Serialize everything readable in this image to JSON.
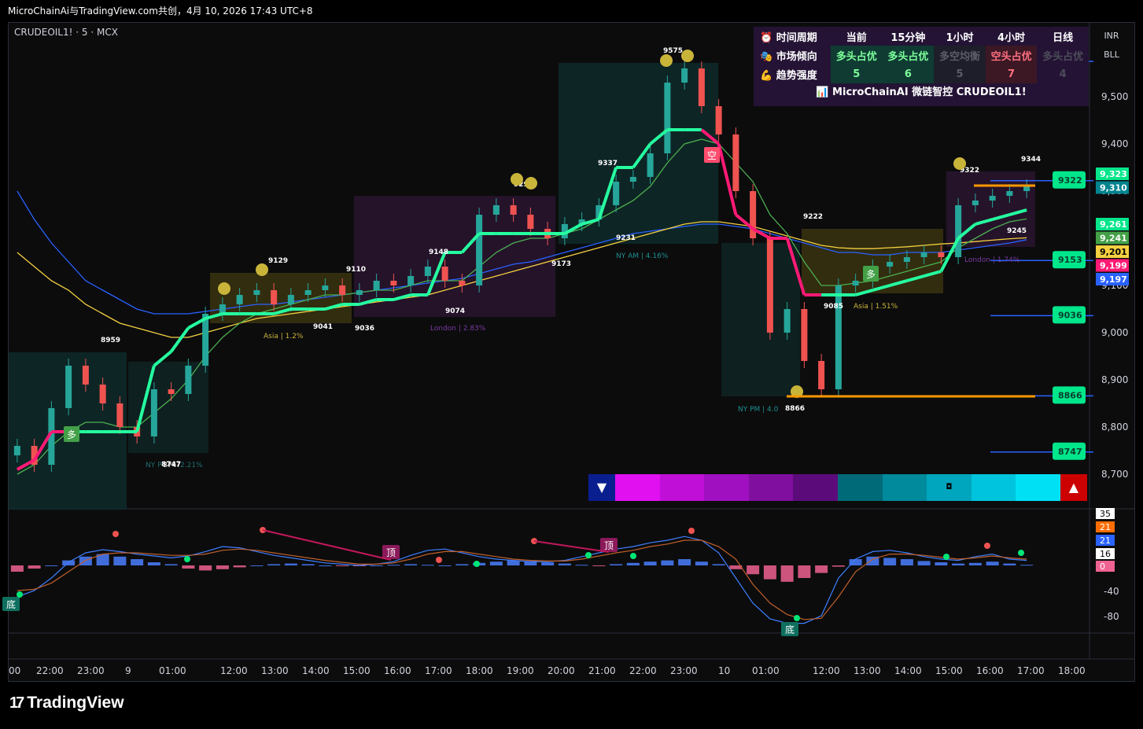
{
  "header": {
    "title": "MicroChainAi与TradingView.com共创，4月 10, 2026 17:43 UTC+8"
  },
  "symbol": {
    "name": "CRUDEOIL1! · 5 · MCX"
  },
  "currency_box": {
    "currency": "INR",
    "unit": "BLL"
  },
  "watermark": "TradingView",
  "info_table": {
    "headers": [
      "时间周期",
      "当前",
      "15分钟",
      "1小时",
      "4小时",
      "日线"
    ],
    "trend_row": {
      "label": "市场倾向",
      "cells": [
        "多头占优",
        "多头占优",
        "多空均衡",
        "空头占优",
        "多头占优"
      ],
      "tones": [
        "bull",
        "bull",
        "neutral",
        "bear",
        "dim"
      ]
    },
    "strength_row": {
      "label": "趋势强度",
      "cells": [
        "5",
        "6",
        "5",
        "7",
        "4"
      ],
      "tones": [
        "bull",
        "bull",
        "neutral",
        "bear",
        "dim"
      ]
    },
    "footer": "MicroChainAI 微链智控 CRUDEOIL1!",
    "icons": [
      "alarm-clock-icon",
      "market-bias-icon",
      "strength-arm-icon",
      "chart-icon"
    ]
  },
  "colors": {
    "bull": "#00e68a",
    "bear": "#ff1a75",
    "trend_line": "#25ffa0",
    "ema_blue": "#2962ff",
    "ema_yellow": "#f5d040",
    "ema_green": "#4caf50",
    "macd_pos": "#4a7fff",
    "macd_neg": "#f06292"
  },
  "chart_data": [
    {
      "type": "candlestick",
      "title": "CRUDEOIL1! · 5 · MCX",
      "x_ticks": [
        "00",
        "22:00",
        "23:00",
        "9",
        "01:00",
        "12:00",
        "13:00",
        "14:00",
        "15:00",
        "16:00",
        "17:00",
        "18:00",
        "19:00",
        "20:00",
        "21:00",
        "22:00",
        "23:00",
        "10",
        "01:00",
        "12:00",
        "13:00",
        "14:00",
        "15:00",
        "16:00",
        "17:00",
        "18:00"
      ],
      "y_ticks": [
        8700,
        8800,
        8900,
        9000,
        9100,
        9200,
        9300,
        9400,
        9500
      ],
      "ylim": [
        8625,
        9625
      ],
      "price_tags": [
        {
          "value": "9,323",
          "color": "#00e68a"
        },
        {
          "value": "9,310",
          "color": "#00838f"
        },
        {
          "value": "9,261",
          "color": "#00e68a"
        },
        {
          "value": "9,241",
          "color": "#43a047"
        },
        {
          "value": "9,201",
          "color": "#f5d040"
        },
        {
          "value": "9,199",
          "color": "#ff1a75"
        },
        {
          "value": "9,197",
          "color": "#2962ff"
        }
      ],
      "level_tags": [
        "9575",
        "9322",
        "9153",
        "9036",
        "8866",
        "8747"
      ],
      "swing_labels": [
        "8959",
        "8747",
        "9129",
        "9041",
        "9110",
        "9036",
        "9148",
        "9074",
        "9292",
        "9173",
        "9337",
        "9231",
        "9575",
        "9222",
        "8866",
        "9085",
        "9322",
        "9344",
        "9245"
      ],
      "session_labels": [
        "NY P",
        "8747",
        "2.21%",
        "Asia | 1.2%",
        "London | 2.83%",
        "NY AM | 4.16%",
        "NY PM | 4.0",
        "Asia | 1.51%",
        "London | 1.74%"
      ],
      "signals": [
        "多",
        "空",
        "多"
      ],
      "series": [
        {
          "name": "close",
          "values": [
            8760,
            8720,
            8840,
            8930,
            8890,
            8850,
            8800,
            8780,
            8880,
            8870,
            8930,
            9040,
            9060,
            9080,
            9090,
            9060,
            9080,
            9090,
            9100,
            9080,
            9090,
            9110,
            9100,
            9120,
            9140,
            9110,
            9100,
            9250,
            9270,
            9250,
            9220,
            9200,
            9230,
            9240,
            9270,
            9320,
            9330,
            9380,
            9530,
            9560,
            9480,
            9420,
            9300,
            9200,
            9000,
            9050,
            8940,
            8880,
            9100,
            9110,
            9140,
            9150,
            9160,
            9170,
            9160,
            9270,
            9280,
            9290,
            9300,
            9310
          ]
        },
        {
          "name": "trend",
          "values": [
            8710,
            8730,
            8790,
            8790,
            8790,
            8790,
            8790,
            8790,
            8930,
            8960,
            9010,
            9030,
            9040,
            9040,
            9040,
            9040,
            9050,
            9050,
            9050,
            9060,
            9060,
            9070,
            9070,
            9080,
            9080,
            9170,
            9170,
            9210,
            9210,
            9210,
            9210,
            9210,
            9210,
            9230,
            9240,
            9350,
            9350,
            9400,
            9430,
            9430,
            9430,
            9400,
            9250,
            9220,
            9200,
            9200,
            9080,
            9080,
            9080,
            9080,
            9090,
            9100,
            9110,
            9120,
            9130,
            9200,
            9230,
            9240,
            9250,
            9260
          ]
        },
        {
          "name": "ema_blue",
          "values": [
            9300,
            9240,
            9190,
            9150,
            9110,
            9090,
            9070,
            9050,
            9040,
            9040,
            9040,
            9045,
            9050,
            9055,
            9060,
            9060,
            9065,
            9070,
            9075,
            9080,
            9085,
            9090,
            9095,
            9100,
            9105,
            9110,
            9115,
            9125,
            9135,
            9145,
            9150,
            9160,
            9170,
            9180,
            9190,
            9200,
            9210,
            9215,
            9220,
            9225,
            9230,
            9230,
            9225,
            9220,
            9210,
            9200,
            9190,
            9180,
            9170,
            9170,
            9165,
            9165,
            9170,
            9170,
            9170,
            9175,
            9180,
            9185,
            9190,
            9197
          ]
        },
        {
          "name": "ema_yellow",
          "values": [
            9170,
            9140,
            9110,
            9090,
            9060,
            9040,
            9020,
            9010,
            9000,
            8990,
            8990,
            9000,
            9010,
            9020,
            9030,
            9035,
            9040,
            9045,
            9050,
            9055,
            9060,
            9065,
            9070,
            9075,
            9080,
            9090,
            9100,
            9110,
            9120,
            9130,
            9140,
            9150,
            9160,
            9170,
            9180,
            9190,
            9200,
            9210,
            9220,
            9230,
            9235,
            9235,
            9230,
            9225,
            9215,
            9205,
            9195,
            9185,
            9180,
            9178,
            9178,
            9180,
            9182,
            9185,
            9188,
            9190,
            9193,
            9196,
            9199,
            9201
          ]
        },
        {
          "name": "ema_green",
          "values": [
            8700,
            8720,
            8760,
            8790,
            8810,
            8810,
            8800,
            8800,
            8830,
            8860,
            8900,
            8950,
            8990,
            9020,
            9040,
            9050,
            9060,
            9070,
            9080,
            9080,
            9085,
            9090,
            9090,
            9100,
            9110,
            9110,
            9110,
            9140,
            9170,
            9190,
            9200,
            9200,
            9210,
            9220,
            9240,
            9260,
            9280,
            9310,
            9360,
            9400,
            9410,
            9400,
            9360,
            9320,
            9250,
            9210,
            9150,
            9100,
            9100,
            9105,
            9110,
            9120,
            9130,
            9140,
            9150,
            9180,
            9200,
            9220,
            9235,
            9241
          ]
        }
      ]
    },
    {
      "type": "bar",
      "title": "",
      "y_ticks": [
        35,
        21,
        21,
        16,
        0,
        -40,
        -80
      ],
      "ylim": [
        -110,
        50
      ],
      "marker_labels": [
        "顶",
        "顶",
        "底",
        "底"
      ],
      "series": [
        {
          "name": "histogram",
          "values": [
            -10,
            -5,
            0,
            8,
            14,
            18,
            14,
            10,
            5,
            2,
            -5,
            -8,
            -6,
            -3,
            0,
            2,
            3,
            2,
            0,
            -1,
            -1,
            0,
            1,
            2,
            1,
            0,
            2,
            4,
            6,
            8,
            7,
            5,
            3,
            1,
            -1,
            2,
            4,
            6,
            8,
            10,
            6,
            2,
            -6,
            -14,
            -22,
            -26,
            -20,
            -12,
            -2,
            10,
            14,
            12,
            10,
            7,
            5,
            3,
            4,
            6,
            3,
            1
          ]
        },
        {
          "name": "fast",
          "values": [
            -50,
            -40,
            -20,
            5,
            20,
            25,
            22,
            18,
            15,
            12,
            15,
            22,
            30,
            28,
            22,
            16,
            12,
            8,
            4,
            2,
            0,
            2,
            6,
            16,
            24,
            26,
            20,
            14,
            10,
            8,
            6,
            6,
            8,
            14,
            20,
            26,
            30,
            36,
            40,
            46,
            40,
            20,
            -20,
            -60,
            -85,
            -92,
            -92,
            -80,
            -20,
            10,
            22,
            24,
            20,
            14,
            10,
            8,
            14,
            18,
            10,
            8
          ]
        },
        {
          "name": "slow",
          "values": [
            -40,
            -38,
            -28,
            -10,
            8,
            18,
            20,
            20,
            18,
            16,
            16,
            18,
            24,
            26,
            24,
            20,
            16,
            12,
            8,
            5,
            2,
            2,
            4,
            10,
            18,
            22,
            22,
            18,
            14,
            10,
            8,
            7,
            7,
            10,
            15,
            20,
            24,
            30,
            34,
            40,
            40,
            30,
            10,
            -30,
            -60,
            -78,
            -86,
            -84,
            -50,
            -10,
            10,
            18,
            18,
            16,
            13,
            10,
            12,
            15,
            12,
            10
          ]
        }
      ]
    }
  ]
}
